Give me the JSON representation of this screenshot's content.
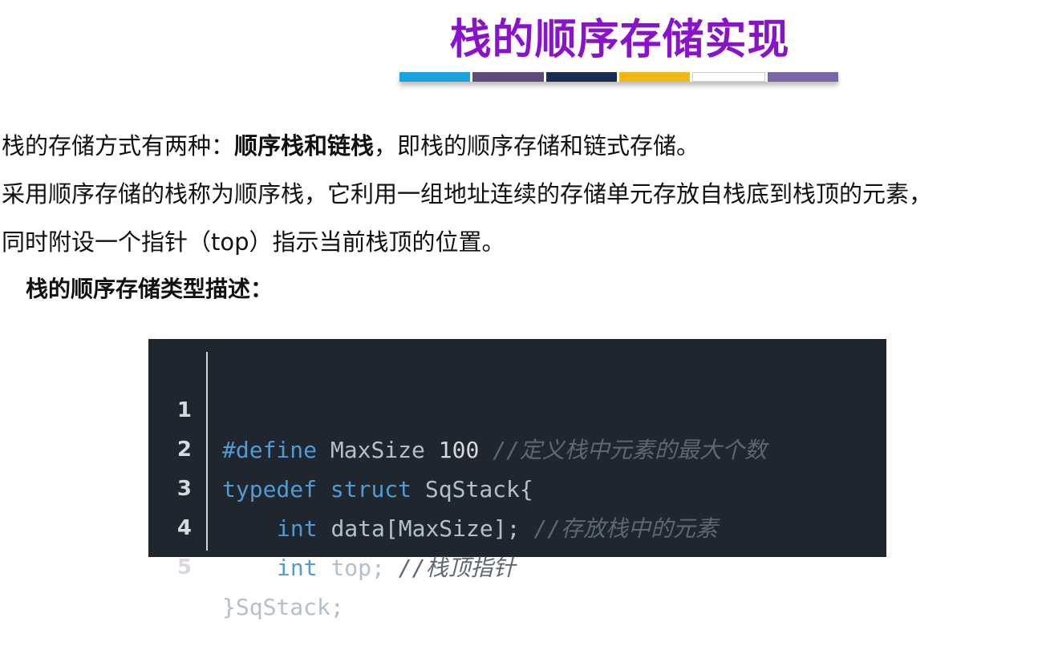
{
  "title": "栈的顺序存储实现",
  "title_bar_colors": [
    "#1aa3dd",
    "#5c4b7d",
    "#1b2c4d",
    "#f2b715",
    "#ffffff",
    "#7a66a6"
  ],
  "paragraphs": {
    "p1_prefix": "栈的存储方式有两种：",
    "p1_bold": "顺序栈和链栈",
    "p1_suffix": "，即栈的顺序存储和链式存储。",
    "p2": "采用顺序存储的栈称为顺序栈，它利用一组地址连续的存储单元存放自栈底到栈顶的元素，",
    "p3": "同时附设一个指针（top）指示当前栈顶的位置。"
  },
  "subheading": "栈的顺序存储类型描述：",
  "code": {
    "line_numbers": [
      "1",
      "2",
      "3",
      "4",
      "5"
    ],
    "l1_directive": "#define",
    "l1_name": "MaxSize",
    "l1_value": "100",
    "l1_comment": "//定义栈中元素的最大个数",
    "l2_kw1": "typedef",
    "l2_kw2": "struct",
    "l2_rest": "SqStack{",
    "l3_type": "int",
    "l3_decl": "data[MaxSize];",
    "l3_comment": "//存放栈中的元素",
    "l4_type": "int",
    "l4_decl": "top;",
    "l4_comment": "//栈顶指针",
    "l5": "}SqStack;"
  }
}
